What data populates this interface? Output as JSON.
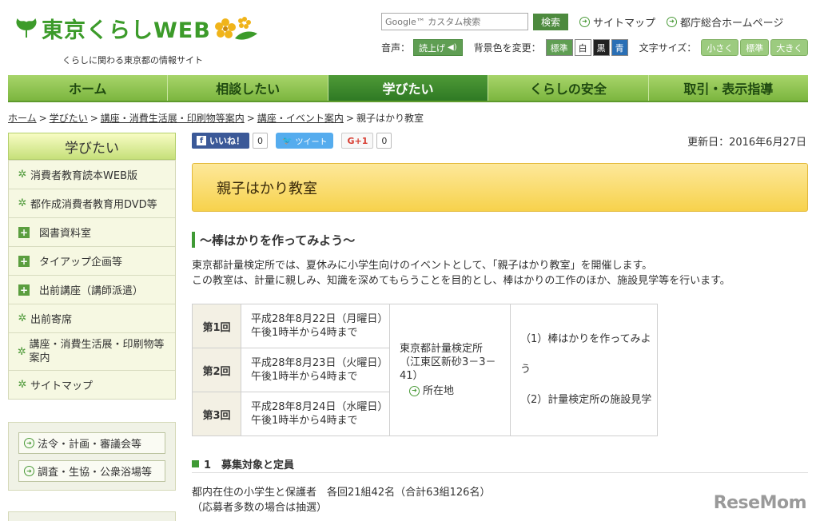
{
  "header": {
    "logo_text": "東京くらしWEB",
    "tagline": "くらしに関わる東京都の情報サイト",
    "search_placeholder": "Google™ カスタム検索",
    "search_button": "検索",
    "links": [
      "サイトマップ",
      "都庁総合ホームページ"
    ],
    "voice_label": "音声：",
    "voice_button": "読上げ",
    "bg_label": "背景色を変更：",
    "bg_buttons": [
      "標準",
      "白",
      "黒",
      "青"
    ],
    "font_label": "文字サイズ：",
    "font_buttons": [
      "小さく",
      "標準",
      "大きく"
    ]
  },
  "nav": {
    "items": [
      "ホーム",
      "相談したい",
      "学びたい",
      "くらしの安全",
      "取引・表示指導"
    ],
    "active_index": 2
  },
  "breadcrumb": {
    "links": [
      "ホーム",
      "学びたい",
      "講座・消費生活展・印刷物等案内",
      "講座・イベント案内"
    ],
    "current": "親子はかり教室"
  },
  "sidebar": {
    "heading": "学びたい",
    "items": [
      {
        "label": "消費者教育読本WEB版",
        "icon": "star"
      },
      {
        "label": "都作成消費者教育用DVD等",
        "icon": "star"
      },
      {
        "label": "図書資料室",
        "icon": "plus"
      },
      {
        "label": "タイアップ企画等",
        "icon": "plus"
      },
      {
        "label": "出前講座（講師派遣）",
        "icon": "plus"
      },
      {
        "label": "出前寄席",
        "icon": "star"
      },
      {
        "label": "講座・消費生活展・印刷物等案内",
        "icon": "star"
      },
      {
        "label": "サイトマップ",
        "icon": "star"
      }
    ],
    "links": [
      "法令・計画・審議会等",
      "調査・生協・公衆浴場等"
    ]
  },
  "social": {
    "like_label": "いいね！",
    "like_count": "0",
    "tweet_label": "ツイート",
    "gplus_label": "G+1",
    "gplus_count": "0"
  },
  "page": {
    "updated": "更新日：2016年6月27日",
    "title": "親子はかり教室",
    "subheading": "～棒はかりを作ってみよう～",
    "intro_lines": [
      "東京都計量検定所では、夏休みに小学生向けのイベントとして、「親子はかり教室」を開催します。",
      "この教室は、計量に親しみ、知識を深めてもらうことを目的とし、棒はかりの工作のほか、施設見学等を行います。"
    ],
    "schedule": [
      {
        "num": "第1回",
        "date": "平成28年8月22日（月曜日）",
        "time": "午後1時半から4時まで"
      },
      {
        "num": "第2回",
        "date": "平成28年8月23日（火曜日）",
        "time": "午後1時半から4時まで"
      },
      {
        "num": "第3回",
        "date": "平成28年8月24日（水曜日）",
        "time": "午後1時半から4時まで"
      }
    ],
    "place_name": "東京都計量検定所",
    "place_address": "（江東区新砂3－3－41）",
    "place_link": "所在地",
    "contents": [
      "（1）棒はかりを作ってみよう",
      "（2）計量検定所の施設見学"
    ],
    "section1_title": "1　募集対象と定員",
    "section1_lines": [
      "都内在住の小学生と保護者　各回21組42名（合計63組126名）",
      "（応募者多数の場合は抽選）"
    ]
  },
  "watermark": "ReseMom",
  "colors": {
    "accent_green": "#3c9b2a",
    "nav_active": "#2f7a24",
    "title_bg": "#f7d24c"
  }
}
